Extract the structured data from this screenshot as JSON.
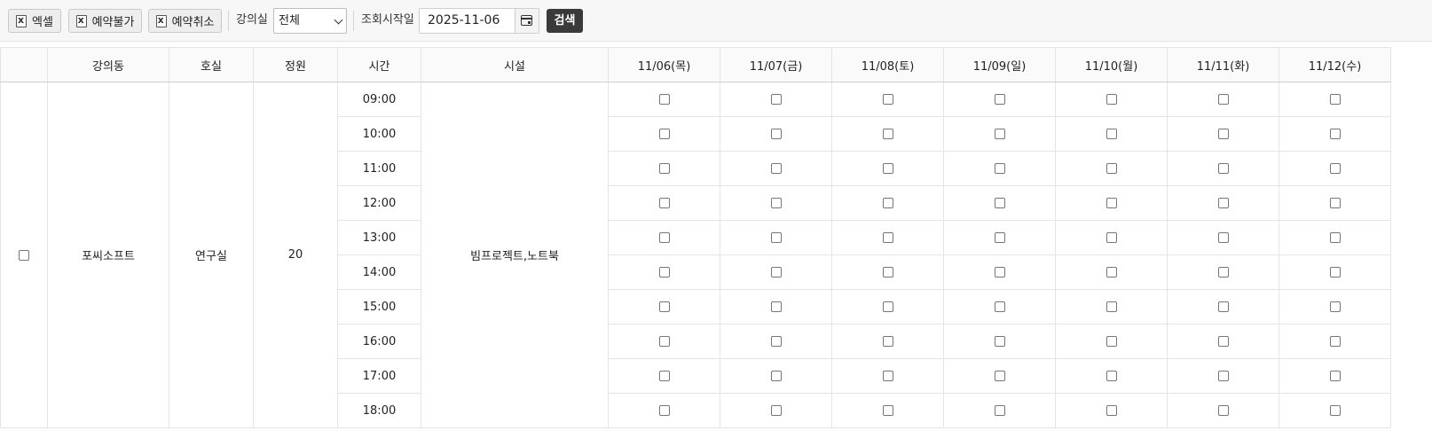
{
  "toolbar": {
    "buttons": [
      "엑셀",
      "예약불가",
      "예약취소"
    ],
    "room_label": "강의실",
    "room_select_value": "전체",
    "start_date_label": "조회시작일",
    "start_date_value": "2025-11-06",
    "search_label": "검색"
  },
  "table": {
    "headers": [
      "강의동",
      "호실",
      "정원",
      "시간",
      "시설",
      "11/06(목)",
      "11/07(금)",
      "11/08(토)",
      "11/09(일)",
      "11/10(월)",
      "11/11(화)",
      "11/12(수)"
    ],
    "row": {
      "building": "포씨소프트",
      "room": "연구실",
      "capacity": "20",
      "facility": "빔프로젝트,노트북"
    },
    "times": [
      "09:00",
      "10:00",
      "11:00",
      "12:00",
      "13:00",
      "14:00",
      "15:00",
      "16:00",
      "17:00",
      "18:00"
    ]
  }
}
